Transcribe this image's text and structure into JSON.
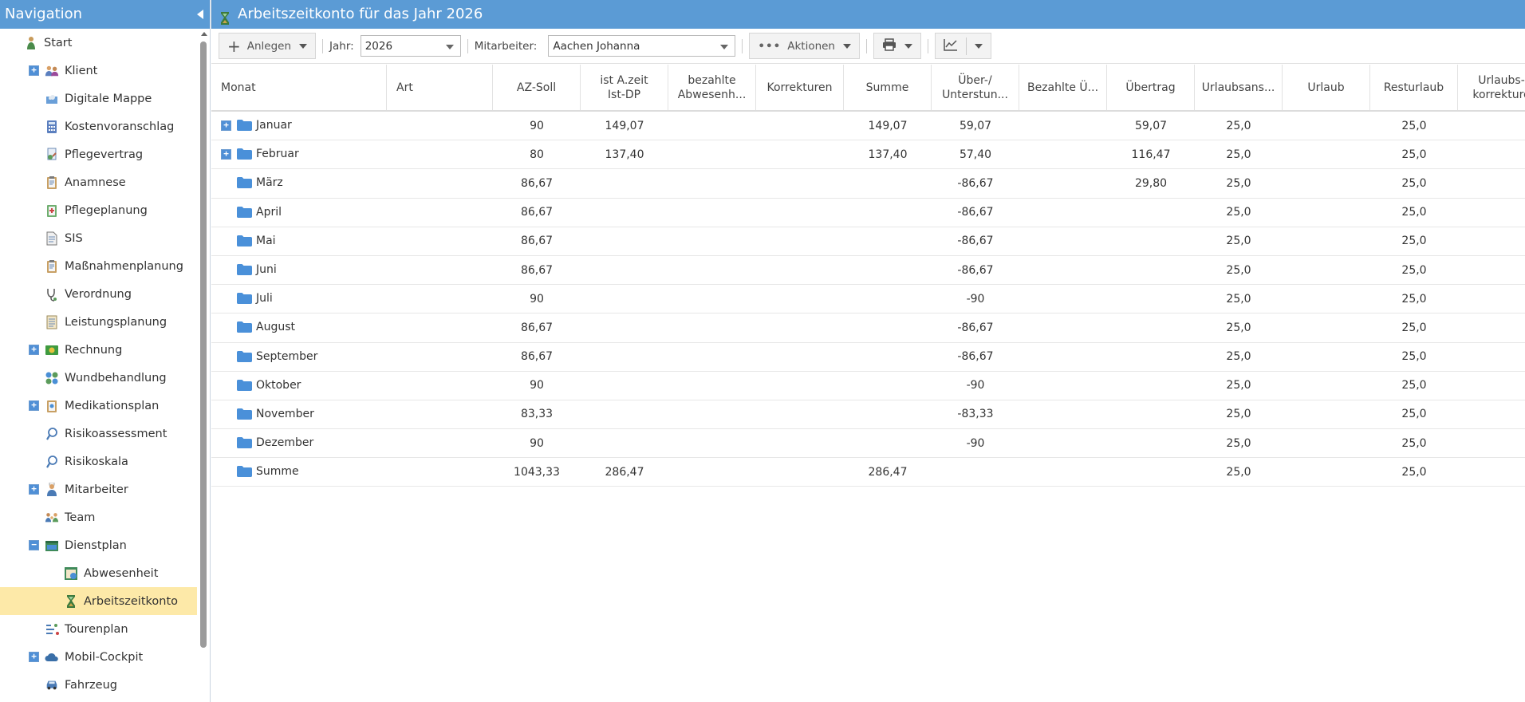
{
  "nav": {
    "title": "Navigation",
    "items": [
      {
        "label": "Start",
        "icon": "start-icon",
        "level": 0,
        "expander": ""
      },
      {
        "label": "Klient",
        "icon": "people-icon",
        "level": 1,
        "expander": "+"
      },
      {
        "label": "Digitale Mappe",
        "icon": "folder-cloud-icon",
        "level": 1,
        "expander": ""
      },
      {
        "label": "Kostenvoranschlag",
        "icon": "calculator-icon",
        "level": 1,
        "expander": ""
      },
      {
        "label": "Pflegevertrag",
        "icon": "contract-icon",
        "level": 1,
        "expander": ""
      },
      {
        "label": "Anamnese",
        "icon": "clipboard-icon",
        "level": 1,
        "expander": ""
      },
      {
        "label": "Pflegeplanung",
        "icon": "planning-icon",
        "level": 1,
        "expander": ""
      },
      {
        "label": "SIS",
        "icon": "document-icon",
        "level": 1,
        "expander": ""
      },
      {
        "label": "Maßnahmenplanung",
        "icon": "clipboard-icon",
        "level": 1,
        "expander": ""
      },
      {
        "label": "Verordnung",
        "icon": "stethoscope-icon",
        "level": 1,
        "expander": ""
      },
      {
        "label": "Leistungsplanung",
        "icon": "list-icon",
        "level": 1,
        "expander": ""
      },
      {
        "label": "Rechnung",
        "icon": "money-icon",
        "level": 1,
        "expander": "+"
      },
      {
        "label": "Wundbehandlung",
        "icon": "bandage-icon",
        "level": 1,
        "expander": ""
      },
      {
        "label": "Medikationsplan",
        "icon": "medication-icon",
        "level": 1,
        "expander": "+"
      },
      {
        "label": "Risikoassessment",
        "icon": "magnifier-icon",
        "level": 1,
        "expander": ""
      },
      {
        "label": "Risikoskala",
        "icon": "magnifier-icon",
        "level": 1,
        "expander": ""
      },
      {
        "label": "Mitarbeiter",
        "icon": "nurse-icon",
        "level": 1,
        "expander": "+"
      },
      {
        "label": "Team",
        "icon": "team-icon",
        "level": 1,
        "expander": ""
      },
      {
        "label": "Dienstplan",
        "icon": "calendar-icon",
        "level": 1,
        "expander": "−"
      },
      {
        "label": "Abwesenheit",
        "icon": "absence-icon",
        "level": 2,
        "expander": ""
      },
      {
        "label": "Arbeitszeitkonto",
        "icon": "hourglass-icon",
        "level": 2,
        "expander": "",
        "selected": true
      },
      {
        "label": "Tourenplan",
        "icon": "route-icon",
        "level": 1,
        "expander": ""
      },
      {
        "label": "Mobil-Cockpit",
        "icon": "cloud-icon",
        "level": 1,
        "expander": "+"
      },
      {
        "label": "Fahrzeug",
        "icon": "car-icon",
        "level": 1,
        "expander": ""
      }
    ]
  },
  "main": {
    "title": "Arbeitszeitkonto für das Jahr 2026",
    "toolbar": {
      "create_label": "Anlegen",
      "year_label": "Jahr:",
      "year_value": "2026",
      "employee_label": "Mitarbeiter:",
      "employee_value": "Aachen Johanna",
      "actions_label": "Aktionen"
    },
    "columns": [
      {
        "key": "monat",
        "label": "Monat",
        "label2": ""
      },
      {
        "key": "art",
        "label": "Art",
        "label2": ""
      },
      {
        "key": "soll",
        "label": "AZ-Soll",
        "label2": ""
      },
      {
        "key": "ist",
        "label": "ist A.zeit",
        "label2": "Ist-DP"
      },
      {
        "key": "abw",
        "label": "bezahlte",
        "label2": "Abwesenh..."
      },
      {
        "key": "korr",
        "label": "Korrekturen",
        "label2": ""
      },
      {
        "key": "summe",
        "label": "Summe",
        "label2": ""
      },
      {
        "key": "ueber",
        "label": "Über-/",
        "label2": "Unterstun..."
      },
      {
        "key": "bezue",
        "label": "Bezahlte Ü...",
        "label2": ""
      },
      {
        "key": "uebertrag",
        "label": "Übertrag",
        "label2": ""
      },
      {
        "key": "ua",
        "label": "Urlaubsans...",
        "label2": ""
      },
      {
        "key": "urlaub",
        "label": "Urlaub",
        "label2": ""
      },
      {
        "key": "rest",
        "label": "Resturlaub",
        "label2": ""
      },
      {
        "key": "uk",
        "label": "Urlaubs-",
        "label2": "korrekture"
      }
    ],
    "rows": [
      {
        "expander": "+",
        "monat": "Januar",
        "art": "",
        "soll": "90",
        "ist": "149,07",
        "abw": "",
        "korr": "",
        "summe": "149,07",
        "ueber": "59,07",
        "bezue": "",
        "uebertrag": "59,07",
        "ua": "25,0",
        "urlaub": "",
        "rest": "25,0",
        "uk": ""
      },
      {
        "expander": "+",
        "monat": "Februar",
        "art": "",
        "soll": "80",
        "ist": "137,40",
        "abw": "",
        "korr": "",
        "summe": "137,40",
        "ueber": "57,40",
        "bezue": "",
        "uebertrag": "116,47",
        "ua": "25,0",
        "urlaub": "",
        "rest": "25,0",
        "uk": ""
      },
      {
        "expander": "",
        "monat": "März",
        "art": "",
        "soll": "86,67",
        "ist": "",
        "abw": "",
        "korr": "",
        "summe": "",
        "ueber": "-86,67",
        "bezue": "",
        "uebertrag": "29,80",
        "ua": "25,0",
        "urlaub": "",
        "rest": "25,0",
        "uk": ""
      },
      {
        "expander": "",
        "monat": "April",
        "art": "",
        "soll": "86,67",
        "ist": "",
        "abw": "",
        "korr": "",
        "summe": "",
        "ueber": "-86,67",
        "bezue": "",
        "uebertrag": "",
        "ua": "25,0",
        "urlaub": "",
        "rest": "25,0",
        "uk": ""
      },
      {
        "expander": "",
        "monat": "Mai",
        "art": "",
        "soll": "86,67",
        "ist": "",
        "abw": "",
        "korr": "",
        "summe": "",
        "ueber": "-86,67",
        "bezue": "",
        "uebertrag": "",
        "ua": "25,0",
        "urlaub": "",
        "rest": "25,0",
        "uk": ""
      },
      {
        "expander": "",
        "monat": "Juni",
        "art": "",
        "soll": "86,67",
        "ist": "",
        "abw": "",
        "korr": "",
        "summe": "",
        "ueber": "-86,67",
        "bezue": "",
        "uebertrag": "",
        "ua": "25,0",
        "urlaub": "",
        "rest": "25,0",
        "uk": ""
      },
      {
        "expander": "",
        "monat": "Juli",
        "art": "",
        "soll": "90",
        "ist": "",
        "abw": "",
        "korr": "",
        "summe": "",
        "ueber": "-90",
        "bezue": "",
        "uebertrag": "",
        "ua": "25,0",
        "urlaub": "",
        "rest": "25,0",
        "uk": ""
      },
      {
        "expander": "",
        "monat": "August",
        "art": "",
        "soll": "86,67",
        "ist": "",
        "abw": "",
        "korr": "",
        "summe": "",
        "ueber": "-86,67",
        "bezue": "",
        "uebertrag": "",
        "ua": "25,0",
        "urlaub": "",
        "rest": "25,0",
        "uk": ""
      },
      {
        "expander": "",
        "monat": "September",
        "art": "",
        "soll": "86,67",
        "ist": "",
        "abw": "",
        "korr": "",
        "summe": "",
        "ueber": "-86,67",
        "bezue": "",
        "uebertrag": "",
        "ua": "25,0",
        "urlaub": "",
        "rest": "25,0",
        "uk": ""
      },
      {
        "expander": "",
        "monat": "Oktober",
        "art": "",
        "soll": "90",
        "ist": "",
        "abw": "",
        "korr": "",
        "summe": "",
        "ueber": "-90",
        "bezue": "",
        "uebertrag": "",
        "ua": "25,0",
        "urlaub": "",
        "rest": "25,0",
        "uk": ""
      },
      {
        "expander": "",
        "monat": "November",
        "art": "",
        "soll": "83,33",
        "ist": "",
        "abw": "",
        "korr": "",
        "summe": "",
        "ueber": "-83,33",
        "bezue": "",
        "uebertrag": "",
        "ua": "25,0",
        "urlaub": "",
        "rest": "25,0",
        "uk": ""
      },
      {
        "expander": "",
        "monat": "Dezember",
        "art": "",
        "soll": "90",
        "ist": "",
        "abw": "",
        "korr": "",
        "summe": "",
        "ueber": "-90",
        "bezue": "",
        "uebertrag": "",
        "ua": "25,0",
        "urlaub": "",
        "rest": "25,0",
        "uk": ""
      },
      {
        "expander": "",
        "monat": "Summe",
        "art": "",
        "soll": "1043,33",
        "ist": "286,47",
        "abw": "",
        "korr": "",
        "summe": "286,47",
        "ueber": "",
        "bezue": "",
        "uebertrag": "",
        "ua": "25,0",
        "urlaub": "",
        "rest": "25,0",
        "uk": ""
      }
    ]
  },
  "colors": {
    "header_blue": "#5b9bd5",
    "selected_row": "#fde9a8",
    "folder_blue": "#4a90d9"
  }
}
